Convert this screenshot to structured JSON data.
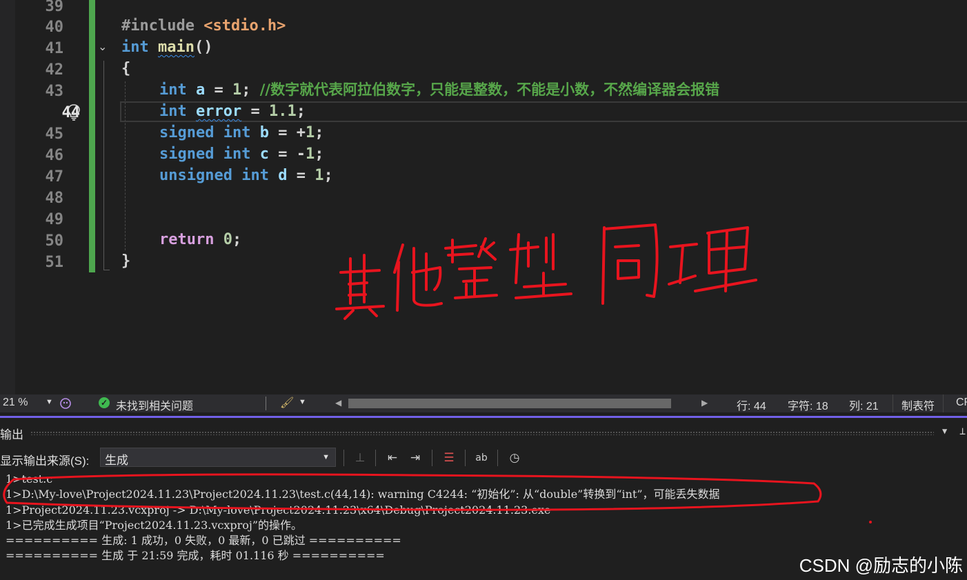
{
  "editor": {
    "line_numbers": [
      "39",
      "40",
      "41",
      "42",
      "43",
      "44",
      "45",
      "46",
      "47",
      "48",
      "49",
      "50",
      "51"
    ],
    "current_line": "44",
    "code": {
      "l40_include": "#include",
      "l40_header": "<stdio.h>",
      "l41_type": "int",
      "l41_func": "main",
      "l41_parens": "()",
      "l42_brace": "{",
      "l43_type": "int",
      "l43_var": "a",
      "l43_eq": " = ",
      "l43_val": "1",
      "l43_semi": "; ",
      "l43_comment": "//数字就代表阿拉伯数字，只能是整数，不能是小数，不然编译器会报错",
      "l44_type": "int",
      "l44_var": "error",
      "l44_eq": " = ",
      "l44_val": "1.1",
      "l44_semi": ";",
      "l45_signed": "signed",
      "l45_type": "int",
      "l45_var": "b",
      "l45_eq": " = +",
      "l45_val": "1",
      "l45_semi": ";",
      "l46_signed": "signed",
      "l46_type": "int",
      "l46_var": "c",
      "l46_eq": " = -",
      "l46_val": "1",
      "l46_semi": ";",
      "l47_unsigned": "unsigned",
      "l47_type": "int",
      "l47_var": "d",
      "l47_eq": " = ",
      "l47_val": "1",
      "l47_semi": ";",
      "l50_return": "return",
      "l50_val": "0",
      "l50_semi": ";",
      "l51_brace": "}"
    },
    "handwritten_note": "其他整型同理"
  },
  "statusbar": {
    "zoom": "21 %",
    "issues": "未找到相关问题",
    "row": "行: 44",
    "char": "字符: 18",
    "col": "列: 21",
    "tabs": "制表符",
    "line_ending": "CR"
  },
  "output": {
    "title": "输出",
    "source_label": "显示输出来源(S):",
    "source_value": "生成",
    "lines": [
      "1>test.c",
      "1>D:\\My-love\\Project2024.11.23\\Project2024.11.23\\test.c(44,14): warning C4244: “初始化”: 从“double”转换到“int”，可能丢失数据",
      "1>Project2024.11.23.vcxproj -> D:\\My-love\\Project2024.11.23\\x64\\Debug\\Project2024.11.23.exe",
      "1>已完成生成项目“Project2024.11.23.vcxproj”的操作。",
      "========== 生成: 1 成功，0 失败，0 最新，0 已跳过 ==========",
      "========== 生成 于 21:59 完成，耗时 01.116 秒 =========="
    ]
  },
  "watermark": "CSDN @励志的小陈",
  "colors": {
    "keyword": "#569cd6",
    "function": "#dcdcaa",
    "comment": "#57a64a",
    "accent": "#7160e8",
    "annotation_red": "#e8141e"
  },
  "icons": [
    "chevron-down-icon",
    "lightbulb-icon",
    "check-circle-icon",
    "brush-icon",
    "clock-icon",
    "pin-icon"
  ]
}
